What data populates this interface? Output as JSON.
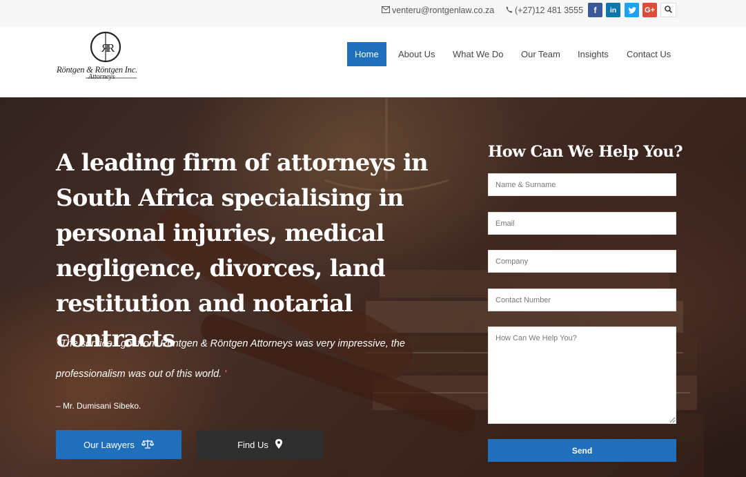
{
  "topbar": {
    "email": "venteru@rontgenlaw.co.za",
    "phone": "(+27)12 481 3555",
    "social": [
      {
        "icon": "facebook-icon",
        "glyph": "f"
      },
      {
        "icon": "linkedin-icon",
        "glyph": "in"
      },
      {
        "icon": "twitter-icon",
        "glyph": "t"
      },
      {
        "icon": "google-plus-icon",
        "glyph": "G+"
      }
    ]
  },
  "logo": {
    "monogram": "R|R",
    "name": "Röntgen & Röntgen Inc.",
    "subtitle": "Attorneys"
  },
  "nav": {
    "items": [
      "Home",
      "About Us",
      "What We Do",
      "Our Team",
      "Insights",
      "Contact Us"
    ],
    "active": "Home"
  },
  "hero": {
    "headline": "A leading firm of attorneys in South Africa specialising in personal injuries, medical negligence, divorces, land restitution and notarial contracts",
    "quote_open": "'",
    "quote": "The service I got from Röntgen & Röntgen Attorneys was very impressive, the professionalism was out of this world.",
    "quote_close": "'",
    "author": "– Mr. Dumisani Sibeko.",
    "button_lawyers": "Our Lawyers",
    "button_find": "Find Us"
  },
  "form": {
    "title": "How Can We Help You?",
    "name_placeholder": "Name & Surname",
    "email_placeholder": "Email",
    "company_placeholder": "Company",
    "phone_placeholder": "Contact Number",
    "message_placeholder": "How Can We Help You?",
    "send_label": "Send"
  },
  "colors": {
    "accent": "#1f6fbd",
    "dark_button": "#2f2f2f",
    "quote_mark": "#ff6a6a"
  }
}
